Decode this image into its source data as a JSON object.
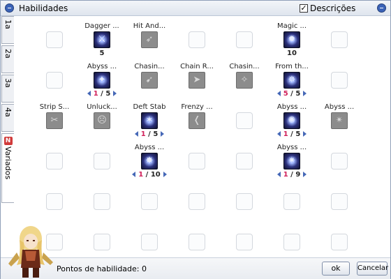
{
  "window": {
    "title": "Habilidades",
    "show_descriptions_label": "Descrições",
    "show_descriptions_checked": true
  },
  "tabs": [
    {
      "label": "1a",
      "active": false
    },
    {
      "label": "2a",
      "active": false
    },
    {
      "label": "3a",
      "active": false
    },
    {
      "label": "4a",
      "active": false
    },
    {
      "label": "Variados",
      "badge": "N",
      "active": true
    }
  ],
  "skills": [
    {
      "name": "Dagger ...",
      "col": 1,
      "row": 0,
      "state": "learned",
      "icon": "dagger-icon",
      "glyph": "⚔",
      "level_text": "5"
    },
    {
      "name": "Hit And...",
      "col": 2,
      "row": 0,
      "state": "locked",
      "icon": "hit-and-run-icon",
      "glyph": "➶"
    },
    {
      "name": "Magic ...",
      "col": 5,
      "row": 0,
      "state": "learned",
      "icon": "magic-icon",
      "glyph": "✹",
      "level_text": "10"
    },
    {
      "name": "Abyss ...",
      "col": 1,
      "row": 1,
      "state": "learned",
      "icon": "abyss-icon",
      "glyph": "✦",
      "cur": "1",
      "max": "5"
    },
    {
      "name": "Chasin...",
      "col": 2,
      "row": 1,
      "state": "locked",
      "icon": "chasing-icon",
      "glyph": "➹"
    },
    {
      "name": "Chain R...",
      "col": 3,
      "row": 1,
      "state": "locked",
      "icon": "chain-icon",
      "glyph": "➤"
    },
    {
      "name": "Chasin...",
      "col": 4,
      "row": 1,
      "state": "locked",
      "icon": "chasing-icon",
      "glyph": "✧"
    },
    {
      "name": "From th...",
      "col": 5,
      "row": 1,
      "state": "learned",
      "icon": "from-the-abyss-icon",
      "glyph": "✵",
      "cur": "5",
      "max": "5"
    },
    {
      "name": "Strip S...",
      "col": 0,
      "row": 2,
      "state": "locked",
      "icon": "strip-icon",
      "glyph": "✂"
    },
    {
      "name": "Unluck...",
      "col": 1,
      "row": 2,
      "state": "locked",
      "icon": "unlucky-icon",
      "glyph": "☹"
    },
    {
      "name": "Deft Stab",
      "col": 2,
      "row": 2,
      "state": "learned",
      "icon": "deft-stab-icon",
      "glyph": "✶",
      "cur": "1",
      "max": "5"
    },
    {
      "name": "Frenzy ...",
      "col": 3,
      "row": 2,
      "state": "locked",
      "icon": "frenzy-icon",
      "glyph": "❬"
    },
    {
      "name": "Abyss ...",
      "col": 5,
      "row": 2,
      "state": "learned",
      "icon": "abyss-icon",
      "glyph": "✺",
      "cur": "1",
      "max": "5"
    },
    {
      "name": "Abyss ...",
      "col": 6,
      "row": 2,
      "state": "locked",
      "icon": "abyss-icon",
      "glyph": "✴"
    },
    {
      "name": "Abyss ...",
      "col": 2,
      "row": 3,
      "state": "learned",
      "icon": "abyss-icon",
      "glyph": "✸",
      "cur": "1",
      "max": "10"
    },
    {
      "name": "Abyss ...",
      "col": 5,
      "row": 3,
      "state": "learned",
      "icon": "abyss-icon",
      "glyph": "✷",
      "cur": "1",
      "max": "9"
    }
  ],
  "footer": {
    "points_label": "Pontos de habilidade: 0",
    "ok_label": "ok",
    "cancel_label": "Cancelar"
  },
  "colors": {
    "level_current": "#d0205a",
    "arrow": "#4668b7",
    "title_button": "#3b63b8"
  }
}
